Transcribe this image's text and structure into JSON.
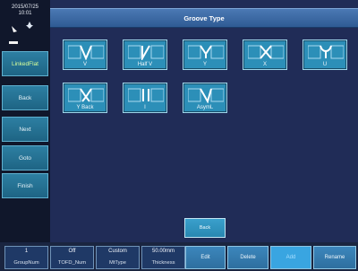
{
  "sidebar": {
    "date": "2015/07/25",
    "time": "10:01",
    "items": [
      {
        "label": "LinkedFlat"
      },
      {
        "label": "Back"
      },
      {
        "label": "Next"
      },
      {
        "label": "Goto"
      },
      {
        "label": "Finish"
      }
    ]
  },
  "dialog": {
    "title": "Groove Type",
    "grooves": [
      {
        "label": "V"
      },
      {
        "label": "Half V"
      },
      {
        "label": "Y"
      },
      {
        "label": "X"
      },
      {
        "label": "U"
      },
      {
        "label": "Y Back"
      },
      {
        "label": "I"
      },
      {
        "label": "AsymL"
      }
    ],
    "back_label": "Back"
  },
  "bottom": {
    "params": [
      {
        "value": "1",
        "label": "GroupNum"
      },
      {
        "value": "Off",
        "label": "TOFD_Num"
      },
      {
        "value": "Custom",
        "label": "MtType"
      },
      {
        "value": "50.00mm",
        "label": "Thickness"
      }
    ],
    "buttons": [
      {
        "label": "Edit"
      },
      {
        "label": "Delete"
      },
      {
        "label": "Add"
      },
      {
        "label": "Rename"
      }
    ]
  },
  "colors": {
    "background": "#1d2845",
    "button_blue": "#2c8fb8",
    "title_blue": "#4b79b4"
  }
}
